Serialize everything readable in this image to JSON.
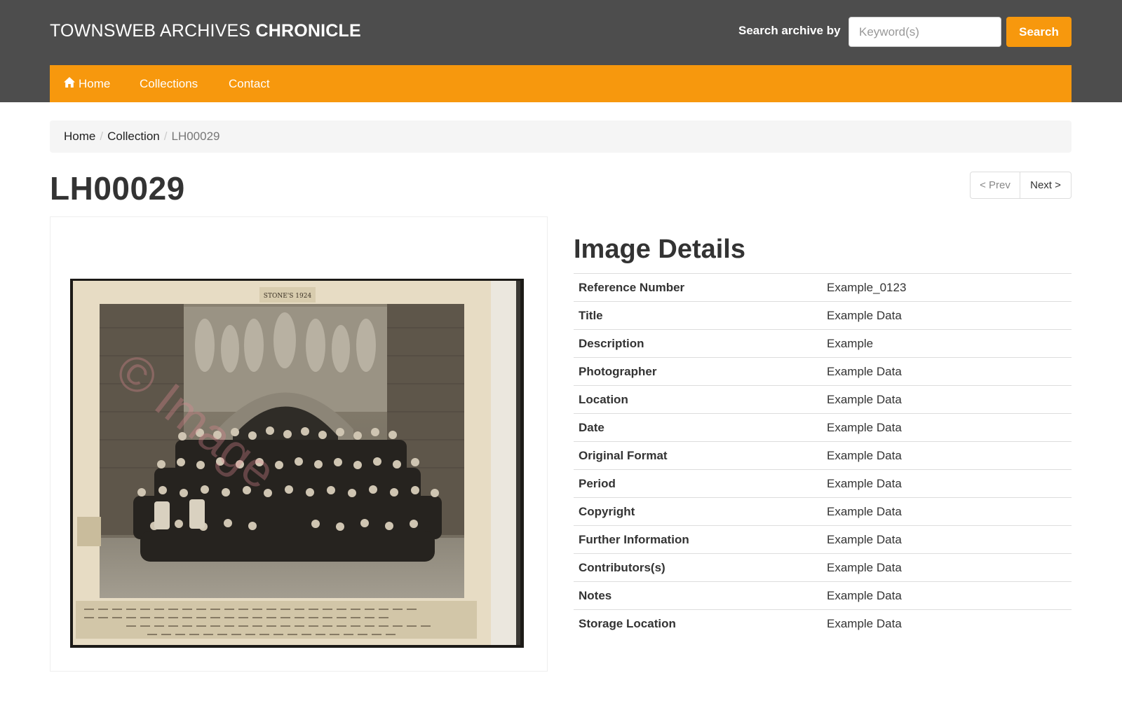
{
  "header": {
    "brand_light": "TOWNSWEB ARCHIVES",
    "brand_bold": "CHRONICLE",
    "search_label": "Search archive by",
    "search_placeholder": "Keyword(s)",
    "search_button": "Search"
  },
  "nav": {
    "items": [
      {
        "label": "Home",
        "icon": "home-icon"
      },
      {
        "label": "Collections"
      },
      {
        "label": "Contact"
      }
    ]
  },
  "breadcrumb": {
    "items": [
      "Home",
      "Collection"
    ],
    "current": "LH00029"
  },
  "page": {
    "title": "LH00029",
    "prev": "< Prev",
    "next": "Next >"
  },
  "photo": {
    "top_label": "STONE'S 1924",
    "watermark": "© Image"
  },
  "details": {
    "heading": "Image Details",
    "rows": [
      {
        "key": "Reference Number",
        "value": "Example_0123"
      },
      {
        "key": "Title",
        "value": "Example Data"
      },
      {
        "key": "Description",
        "value": "Example"
      },
      {
        "key": "Photographer",
        "value": "Example Data"
      },
      {
        "key": "Location",
        "value": "Example Data"
      },
      {
        "key": "Date",
        "value": "Example Data"
      },
      {
        "key": "Original Format",
        "value": "Example Data"
      },
      {
        "key": "Period",
        "value": "Example Data"
      },
      {
        "key": "Copyright",
        "value": "Example Data"
      },
      {
        "key": "Further Information",
        "value": "Example Data"
      },
      {
        "key": "Contributors(s)",
        "value": "Example Data"
      },
      {
        "key": "Notes",
        "value": "Example Data"
      },
      {
        "key": "Storage Location",
        "value": "Example Data"
      }
    ]
  },
  "colors": {
    "header_bg": "#4d4d4d",
    "accent": "#f7980d",
    "breadcrumb_bg": "#f5f5f5"
  }
}
